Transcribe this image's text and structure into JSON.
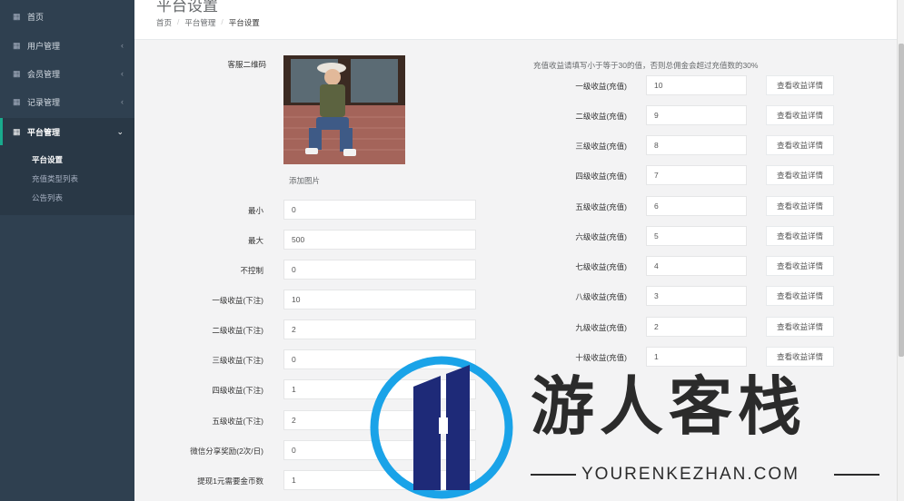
{
  "sidebar": {
    "items": [
      {
        "label": "首页",
        "icon": "grid-icon",
        "has_chevron": false
      },
      {
        "label": "用户管理",
        "icon": "grid-icon",
        "has_chevron": true
      },
      {
        "label": "会员管理",
        "icon": "grid-icon",
        "has_chevron": true
      },
      {
        "label": "记录管理",
        "icon": "grid-icon",
        "has_chevron": true
      },
      {
        "label": "平台管理",
        "icon": "grid-icon",
        "has_chevron": true,
        "expanded": true
      }
    ],
    "sub_items": [
      {
        "label": "平台设置",
        "active": true
      },
      {
        "label": "充值类型列表",
        "active": false
      },
      {
        "label": "公告列表",
        "active": false
      }
    ],
    "accent_color": "#19aa8d",
    "bg_color": "#2f4050"
  },
  "header": {
    "title": "平台设置",
    "breadcrumb": [
      "首页",
      "平台管理",
      "平台设置"
    ]
  },
  "left_form": {
    "qr_label": "客服二维码",
    "add_image_label": "添加图片",
    "fields": [
      {
        "label": "最小",
        "value": "0"
      },
      {
        "label": "最大",
        "value": "500"
      },
      {
        "label": "不控制",
        "value": "0"
      },
      {
        "label": "一级收益(下注)",
        "value": "10"
      },
      {
        "label": "二级收益(下注)",
        "value": "2"
      },
      {
        "label": "三级收益(下注)",
        "value": "0"
      },
      {
        "label": "四级收益(下注)",
        "value": "1"
      },
      {
        "label": "五级收益(下注)",
        "value": "2"
      },
      {
        "label": "微信分享奖励(2次/日)",
        "value": "0"
      },
      {
        "label": "提现1元需要金币数",
        "value": "1"
      }
    ]
  },
  "right_form": {
    "notice": "充值收益请填写小于等于30的值，否则总佣金会超过充值数的30%",
    "detail_button_label": "查看收益详情",
    "fields": [
      {
        "label": "一级收益(充值)",
        "value": "10"
      },
      {
        "label": "二级收益(充值)",
        "value": "9"
      },
      {
        "label": "三级收益(充值)",
        "value": "8"
      },
      {
        "label": "四级收益(充值)",
        "value": "7"
      },
      {
        "label": "五级收益(充值)",
        "value": "6"
      },
      {
        "label": "六级收益(充值)",
        "value": "5"
      },
      {
        "label": "七级收益(充值)",
        "value": "4"
      },
      {
        "label": "八级收益(充值)",
        "value": "3"
      },
      {
        "label": "九级收益(充值)",
        "value": "2"
      },
      {
        "label": "十级收益(充值)",
        "value": "1"
      }
    ]
  },
  "watermark": {
    "title": "游人客栈",
    "subtitle": "YOURENKEZHAN.COM"
  }
}
